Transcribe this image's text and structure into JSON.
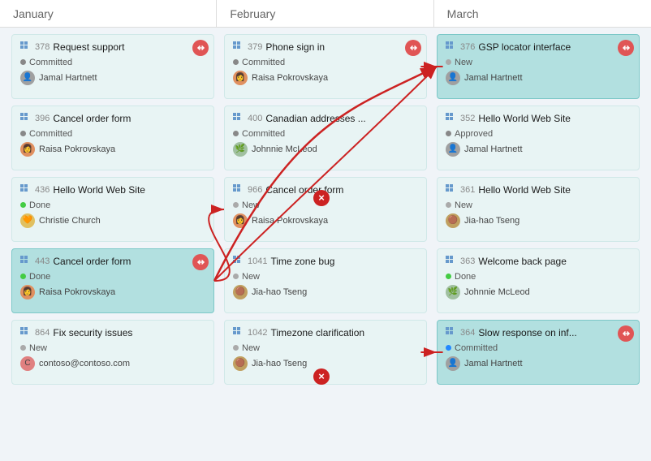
{
  "months": [
    "January",
    "February",
    "March"
  ],
  "columns": [
    {
      "month": "January",
      "cards": [
        {
          "id": "378",
          "name": "Request support",
          "status": "Committed",
          "statusType": "committed",
          "user": "Jamal Hartnett",
          "avatarType": "jamal",
          "hasLink": true,
          "highlighted": false
        },
        {
          "id": "396",
          "name": "Cancel order form",
          "status": "Committed",
          "statusType": "committed",
          "user": "Raisa Pokrovskaya",
          "avatarType": "raisa",
          "hasLink": false,
          "highlighted": false
        },
        {
          "id": "436",
          "name": "Hello World Web Site",
          "status": "Done",
          "statusType": "done",
          "user": "Christie Church",
          "avatarType": "christie",
          "hasLink": false,
          "highlighted": false
        },
        {
          "id": "443",
          "name": "Cancel order form",
          "status": "Done",
          "statusType": "done",
          "user": "Raisa Pokrovskaya",
          "avatarType": "raisa",
          "hasLink": true,
          "highlighted": true
        },
        {
          "id": "864",
          "name": "Fix security issues",
          "status": "New",
          "statusType": "new",
          "user": "contoso@contoso.com",
          "avatarType": "contoso",
          "hasLink": false,
          "highlighted": false
        }
      ]
    },
    {
      "month": "February",
      "cards": [
        {
          "id": "379",
          "name": "Phone sign in",
          "status": "Committed",
          "statusType": "committed",
          "user": "Raisa Pokrovskaya",
          "avatarType": "raisa",
          "hasLink": true,
          "highlighted": false
        },
        {
          "id": "400",
          "name": "Canadian addresses ...",
          "status": "Committed",
          "statusType": "committed",
          "user": "Johnnie McLeod",
          "avatarType": "johnnie",
          "hasLink": false,
          "highlighted": false
        },
        {
          "id": "966",
          "name": "Cancel order form",
          "status": "New",
          "statusType": "new",
          "user": "Raisa Pokrovskaya",
          "avatarType": "raisa",
          "hasLink": false,
          "highlighted": false
        },
        {
          "id": "1041",
          "name": "Time zone bug",
          "status": "New",
          "statusType": "new",
          "user": "Jia-hao Tseng",
          "avatarType": "jiahao",
          "hasLink": false,
          "highlighted": false
        },
        {
          "id": "1042",
          "name": "Timezone clarification",
          "status": "New",
          "statusType": "new",
          "user": "Jia-hao Tseng",
          "avatarType": "jiahao",
          "hasLink": false,
          "highlighted": false
        }
      ]
    },
    {
      "month": "March",
      "cards": [
        {
          "id": "376",
          "name": "GSP locator interface",
          "status": "New",
          "statusType": "new",
          "user": "Jamal Hartnett",
          "avatarType": "jamal",
          "hasLink": true,
          "highlighted": true
        },
        {
          "id": "352",
          "name": "Hello World Web Site",
          "status": "Approved",
          "statusType": "approved",
          "user": "Jamal Hartnett",
          "avatarType": "jamal",
          "hasLink": false,
          "highlighted": false
        },
        {
          "id": "361",
          "name": "Hello World Web Site",
          "status": "New",
          "statusType": "new",
          "user": "Jia-hao Tseng",
          "avatarType": "jiahao",
          "hasLink": false,
          "highlighted": false
        },
        {
          "id": "363",
          "name": "Welcome back page",
          "status": "Done",
          "statusType": "done",
          "user": "Johnnie McLeod",
          "avatarType": "johnnie",
          "hasLink": false,
          "highlighted": false
        },
        {
          "id": "364",
          "name": "Slow response on inf...",
          "status": "Committed",
          "statusType": "committed-blue",
          "user": "Jamal Hartnett",
          "avatarType": "jamal",
          "hasLink": true,
          "highlighted": true
        }
      ]
    }
  ]
}
